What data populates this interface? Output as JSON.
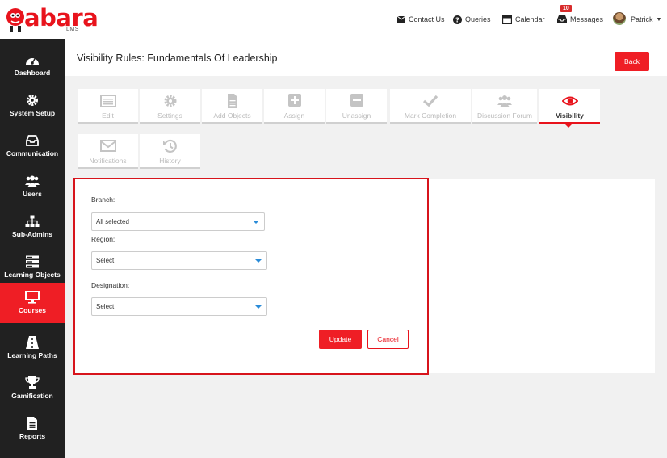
{
  "brand": {
    "name": "abara",
    "sub": "LMS",
    "color": "#e8131c"
  },
  "topnav": {
    "contact_label": "Contact Us",
    "queries_label": "Queries",
    "calendar_label": "Calendar",
    "messages_label": "Messages",
    "messages_badge": "10",
    "user_name": "Patrick"
  },
  "sidebar": {
    "items": [
      {
        "label": "Dashboard",
        "icon": "dashboard-icon"
      },
      {
        "label": "System Setup",
        "icon": "gear-icon"
      },
      {
        "label": "Communication",
        "icon": "inbox-icon"
      },
      {
        "label": "Users",
        "icon": "users-icon"
      },
      {
        "label": "Sub-Admins",
        "icon": "sitemap-icon"
      },
      {
        "label": "Learning Objects",
        "icon": "server-icon"
      },
      {
        "label": "Courses",
        "icon": "monitor-icon",
        "active": true
      },
      {
        "label": "Learning Paths",
        "icon": "road-icon"
      },
      {
        "label": "Gamification",
        "icon": "trophy-icon"
      },
      {
        "label": "Reports",
        "icon": "file-icon"
      }
    ]
  },
  "page": {
    "title": "Visibility Rules: Fundamentals Of Leadership",
    "back_label": "Back"
  },
  "tabs": [
    {
      "label": "Edit",
      "icon": "list-icon"
    },
    {
      "label": "Settings",
      "icon": "gear-icon"
    },
    {
      "label": "Add Objects",
      "icon": "file-icon"
    },
    {
      "label": "Assign",
      "icon": "plus-icon"
    },
    {
      "label": "Unassign",
      "icon": "minus-icon"
    },
    {
      "label": "Mark Completion",
      "icon": "check-icon"
    },
    {
      "label": "Discussion Forum",
      "icon": "users-icon"
    },
    {
      "label": "Visibility",
      "icon": "eye-icon",
      "active": true
    },
    {
      "label": "Notifications",
      "icon": "envelope-icon"
    },
    {
      "label": "History",
      "icon": "history-icon"
    }
  ],
  "form": {
    "branch_label": "Branch:",
    "branch_value": "All selected",
    "region_label": "Region:",
    "region_value": "Select",
    "designation_label": "Designation:",
    "designation_value": "Select",
    "update_label": "Update",
    "cancel_label": "Cancel"
  }
}
